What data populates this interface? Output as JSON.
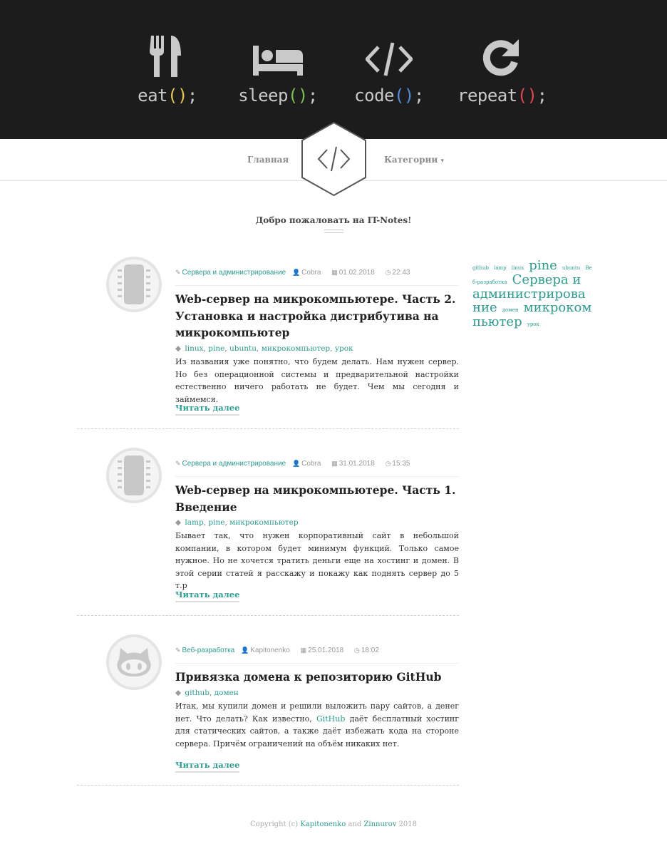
{
  "banner": {
    "items": [
      {
        "word": "eat",
        "parens": "()",
        "semi": ";",
        "icon": "fork-knife-icon"
      },
      {
        "word": "sleep",
        "parens": "()",
        "semi": ";",
        "icon": "bed-icon"
      },
      {
        "word": "code",
        "parens": "()",
        "semi": ";",
        "icon": "code-icon"
      },
      {
        "word": "repeat",
        "parens": "()",
        "semi": ";",
        "icon": "redo-icon"
      }
    ],
    "colors": {
      "background": "#1c1c1c",
      "eat": "#e6c84b",
      "sleep": "#77c24a",
      "code": "#4f8fe0",
      "repeat": "#e0484a"
    }
  },
  "nav": {
    "home": "Главная",
    "categories": "Категории",
    "caret": "▾"
  },
  "welcome": "Добро пожаловать на IT-Notes!",
  "accent": "#2a9d8f",
  "posts": [
    {
      "avatar_icon": "chip-icon",
      "category": "Сервера и администрирование",
      "author": "Cobra",
      "date": "01.02.2018",
      "time": "22:43",
      "title": "Web-сервер на микрокомпьютере. Часть 2. Установка и настройка дистрибутива на микрокомпьютер",
      "tags": [
        "linux",
        "pine",
        "ubuntu",
        "микрокомпьютер",
        "урок"
      ],
      "excerpt": "Из названия уже понятно, что будем делать. Нам нужен сервер. Но без операционной системы и предварительной настройки естественно ничего работать не будет. Чем мы сегодня и займемся.",
      "read_more": "Читать далее"
    },
    {
      "avatar_icon": "chip-icon",
      "category": "Сервера и администрирование",
      "author": "Cobra",
      "date": "31.01.2018",
      "time": "15:35",
      "title": "Web-сервер на микрокомпьютере. Часть 1. Введение",
      "tags": [
        "lamp",
        "pine",
        "микрокомпьютер"
      ],
      "excerpt": "Бывает так, что нужен корпоративный сайт в небольшой компании, в котором будет минимум функций. Только самое нужное. Но не хочется тратить деньги еще на хостинг и домен. В этой серии статей я расскажу и покажу как поднять сервер до 5 т.р",
      "read_more": "Читать далее"
    },
    {
      "avatar_icon": "github-icon",
      "category": "Веб-разработка",
      "author": "Kapitonenko",
      "date": "25.01.2018",
      "time": "18:02",
      "title": "Привязка домена к репозиторию GitHub",
      "tags": [
        "github",
        "домен"
      ],
      "excerpt_before": "Итак, мы купили домен и решили выложить пару сайтов, а денег нет. Что делать? Как известно, ",
      "excerpt_link": "GitHub",
      "excerpt_after": " даёт бесплатный хостинг для статических сайтов, а также даёт избежать кода на стороне сервера. Причём ограничений на объём никаких нет.",
      "read_more": "Читать далее"
    }
  ],
  "tag_cloud": [
    {
      "text": "github",
      "size": "small"
    },
    {
      "text": "lamp",
      "size": "small"
    },
    {
      "text": "linux",
      "size": "small"
    },
    {
      "text": "pine",
      "size": "large"
    },
    {
      "text": "ubuntu",
      "size": "small"
    },
    {
      "text": "Веб-разработка",
      "size": "small"
    },
    {
      "text": "Сервера и администрирование",
      "size": "large"
    },
    {
      "text": "домен",
      "size": "small"
    },
    {
      "text": "микрокомпьютер",
      "size": "large"
    },
    {
      "text": "урок",
      "size": "small"
    }
  ],
  "footer": {
    "prefix": "Copyright (c)",
    "author1": "Kapitonenko",
    "and": "and",
    "author2": "Zinnurov",
    "year": "2018"
  }
}
